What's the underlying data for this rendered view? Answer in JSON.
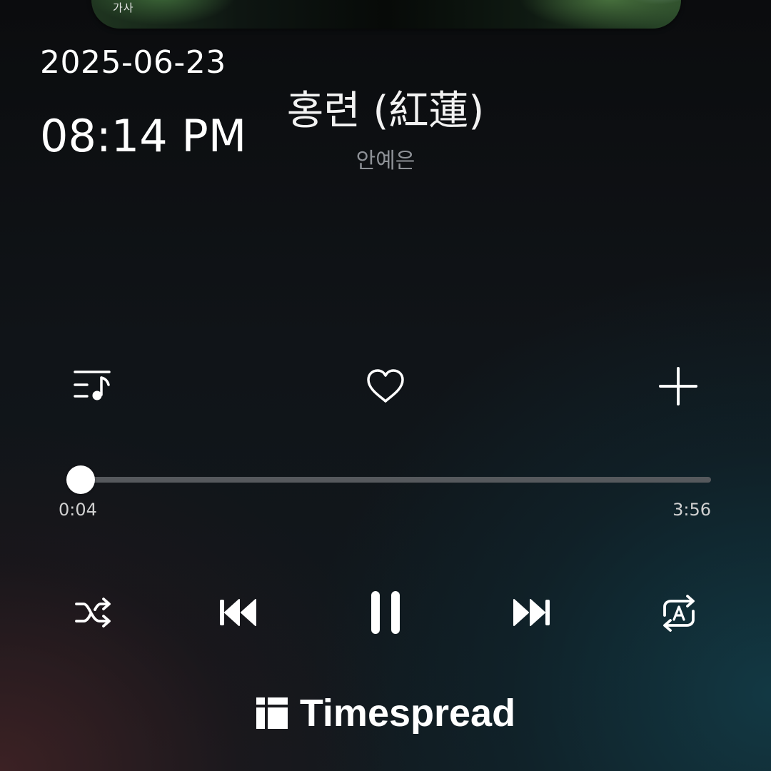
{
  "album": {
    "label": "가사"
  },
  "overlay": {
    "date": "2025-06-23",
    "time": "08:14 PM"
  },
  "track": {
    "title": "홍련 (紅蓮)",
    "artist": "안예은"
  },
  "actions": {
    "lyrics_icon": "lyrics-queue-icon",
    "like_icon": "heart-outline-icon",
    "add_icon": "plus-icon"
  },
  "playback": {
    "elapsed": "0:04",
    "total": "3:56",
    "progress_fraction": 0.017
  },
  "controls": {
    "shuffle_icon": "shuffle-icon",
    "previous_icon": "skip-previous-icon",
    "pause_icon": "pause-icon",
    "next_icon": "skip-next-icon",
    "repeat_icon": "repeat-a-icon"
  },
  "brand": {
    "name": "Timespread"
  },
  "colors": {
    "text_primary": "#ffffff",
    "text_secondary": "#8e9297",
    "track_bg": "#56595d",
    "thumb": "#ffffff"
  }
}
